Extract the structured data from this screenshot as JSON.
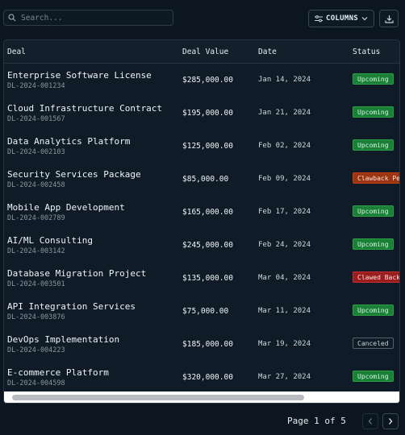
{
  "toolbar": {
    "search_placeholder": "Search...",
    "columns_label": "COLUMNS"
  },
  "table": {
    "headers": {
      "deal": "Deal",
      "value": "Deal Value",
      "date": "Date",
      "status": "Status"
    },
    "rows": [
      {
        "name": "Enterprise Software License",
        "id": "DL-2024-001234",
        "value": "$285,000.00",
        "date": "Jan 14, 2024",
        "status": "Upcoming",
        "status_type": "upcoming"
      },
      {
        "name": "Cloud Infrastructure Contract",
        "id": "DL-2024-001567",
        "value": "$195,000.00",
        "date": "Jan 21, 2024",
        "status": "Upcoming",
        "status_type": "upcoming"
      },
      {
        "name": "Data Analytics Platform",
        "id": "DL-2024-002103",
        "value": "$125,000.00",
        "date": "Feb 02, 2024",
        "status": "Upcoming",
        "status_type": "upcoming"
      },
      {
        "name": "Security Services Package",
        "id": "DL-2024-002458",
        "value": "$85,000.00",
        "date": "Feb 09, 2024",
        "status": "Clawback Pe",
        "status_type": "clawback"
      },
      {
        "name": "Mobile App Development",
        "id": "DL-2024-002789",
        "value": "$165,000.00",
        "date": "Feb 17, 2024",
        "status": "Upcoming",
        "status_type": "upcoming"
      },
      {
        "name": "AI/ML Consulting",
        "id": "DL-2024-003142",
        "value": "$245,000.00",
        "date": "Feb 24, 2024",
        "status": "Upcoming",
        "status_type": "upcoming"
      },
      {
        "name": "Database Migration Project",
        "id": "DL-2024-003501",
        "value": "$135,000.00",
        "date": "Mar 04, 2024",
        "status": "Clawed Back",
        "status_type": "clawed"
      },
      {
        "name": "API Integration Services",
        "id": "DL-2024-003876",
        "value": "$75,000.00",
        "date": "Mar 11, 2024",
        "status": "Upcoming",
        "status_type": "upcoming"
      },
      {
        "name": "DevOps Implementation",
        "id": "DL-2024-004223",
        "value": "$185,000.00",
        "date": "Mar 19, 2024",
        "status": "Canceled",
        "status_type": "canceled"
      },
      {
        "name": "E-commerce Platform",
        "id": "DL-2024-004598",
        "value": "$320,000.00",
        "date": "Mar 27, 2024",
        "status": "Upcoming",
        "status_type": "upcoming"
      }
    ]
  },
  "pagination": {
    "label": "Page 1 of 5"
  },
  "icons": {
    "search": "search-icon",
    "columns": "columns-icon",
    "chevron": "chevron-down-icon",
    "download": "download-icon",
    "prev": "chevron-left-icon",
    "next": "chevron-right-icon"
  }
}
